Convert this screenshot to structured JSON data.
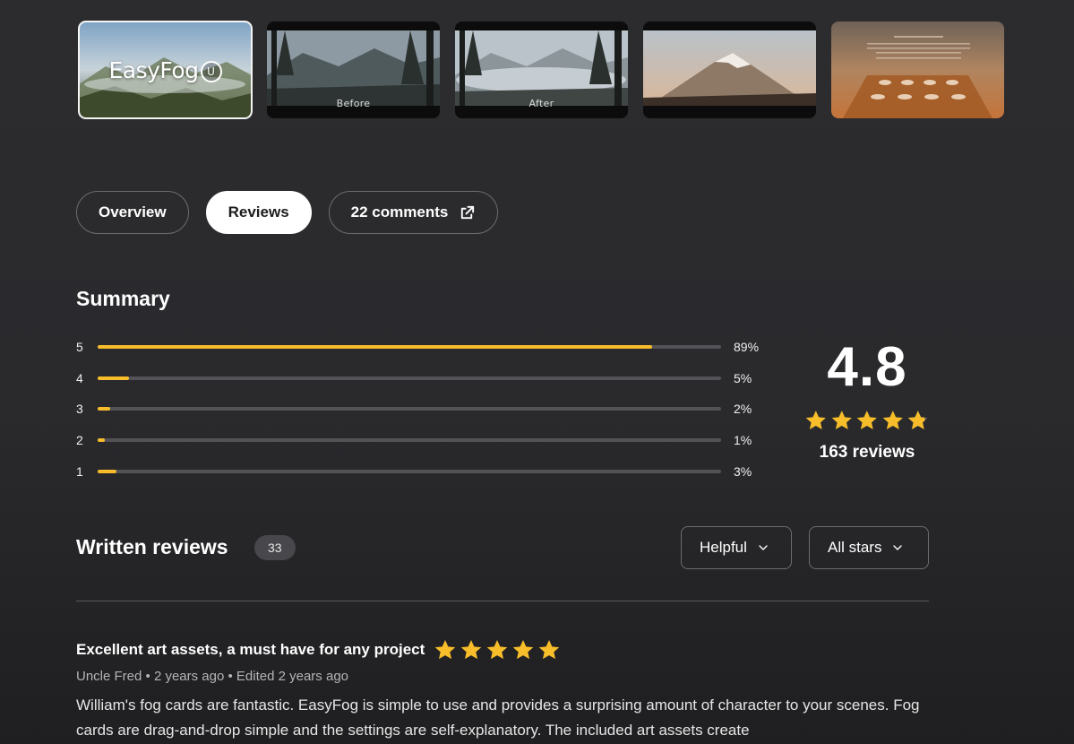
{
  "gallery": {
    "thumbnails": [
      {
        "caption": "",
        "logo_text": "EasyFog",
        "logo_badge": "U",
        "selected": true
      },
      {
        "caption": "Before",
        "selected": false
      },
      {
        "caption": "After",
        "selected": false
      },
      {
        "caption": "",
        "selected": false
      },
      {
        "caption": "",
        "selected": false
      }
    ]
  },
  "tabs": [
    {
      "label": "Overview",
      "active": false
    },
    {
      "label": "Reviews",
      "active": true
    },
    {
      "label": "22 comments",
      "active": false,
      "icon": "external-link-icon"
    }
  ],
  "summary": {
    "title": "Summary",
    "distribution": [
      {
        "stars": "5",
        "percent": "89%",
        "fraction": 0.89
      },
      {
        "stars": "4",
        "percent": "5%",
        "fraction": 0.05
      },
      {
        "stars": "3",
        "percent": "2%",
        "fraction": 0.02
      },
      {
        "stars": "2",
        "percent": "1%",
        "fraction": 0.01
      },
      {
        "stars": "1",
        "percent": "3%",
        "fraction": 0.03
      }
    ],
    "average": "4.8",
    "average_stars": 4.8,
    "review_count": "163 reviews"
  },
  "written_reviews": {
    "title": "Written reviews",
    "count": "33",
    "sort_select": "Helpful",
    "filter_select": "All stars"
  },
  "reviews": [
    {
      "title": "Excellent art assets, a must have for any project",
      "stars": 5,
      "meta": "Uncle Fred • 2 years ago • Edited 2 years ago",
      "body": "William's fog cards are fantastic. EasyFog is simple to use and provides a surprising amount of character to your scenes. Fog cards are drag-and-drop simple and the settings are self-explanatory. The included art assets create"
    }
  ],
  "colors": {
    "accent_star": "#f7bd2a",
    "track": "#535357",
    "background": "#2c2c2f"
  }
}
